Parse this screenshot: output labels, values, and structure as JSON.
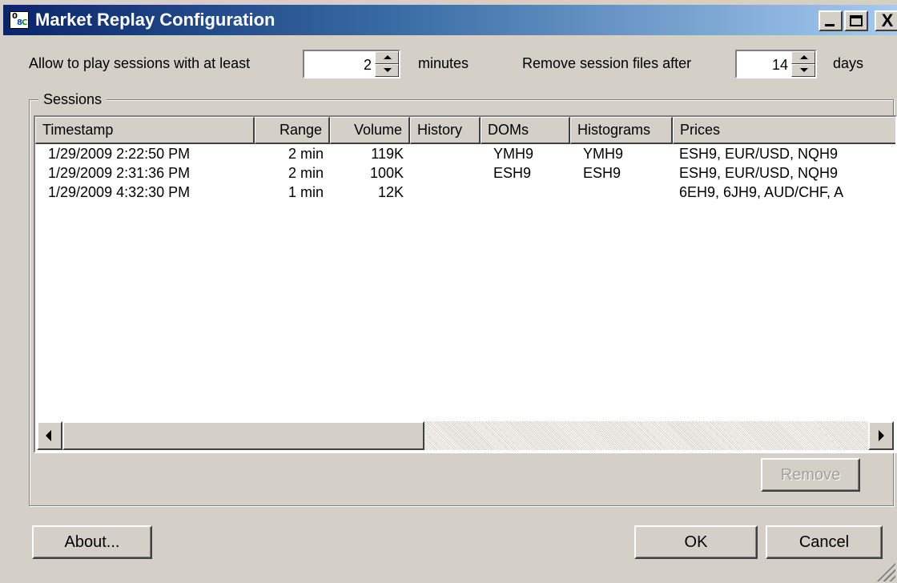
{
  "window": {
    "title": "Market Replay Configuration",
    "icon_name": "app-logo-icon",
    "icon_letters": [
      "0",
      "8",
      "C"
    ],
    "controls": {
      "close_glyph": "X"
    }
  },
  "settings": {
    "min_session_label": "Allow to play sessions with at least",
    "min_session_value": "2",
    "min_session_unit": "minutes",
    "remove_label": "Remove session files after",
    "remove_value": "14",
    "remove_unit": "days"
  },
  "sessions": {
    "group_label": "Sessions",
    "columns": [
      "Timestamp",
      "Range",
      "Volume",
      "History",
      "DOMs",
      "Histograms",
      "Prices"
    ],
    "rows": [
      {
        "timestamp": "1/29/2009 2:22:50 PM",
        "range": "2 min",
        "volume": "119K",
        "history": "",
        "doms": "YMH9",
        "histograms": "YMH9",
        "prices": "ESH9, EUR/USD, NQH9"
      },
      {
        "timestamp": "1/29/2009 2:31:36 PM",
        "range": "2 min",
        "volume": "100K",
        "history": "",
        "doms": "ESH9",
        "histograms": "ESH9",
        "prices": "ESH9, EUR/USD, NQH9"
      },
      {
        "timestamp": "1/29/2009 4:32:30 PM",
        "range": "1 min",
        "volume": "12K",
        "history": "",
        "doms": "",
        "histograms": "",
        "prices": "6EH9, 6JH9, AUD/CHF, A"
      }
    ],
    "remove_label": "Remove"
  },
  "footer": {
    "about_label": "About...",
    "ok_label": "OK",
    "cancel_label": "Cancel"
  },
  "colors": {
    "title_gradient_start": "#0a246a",
    "title_gradient_end": "#a6caf0",
    "face": "#d4d0c8"
  }
}
